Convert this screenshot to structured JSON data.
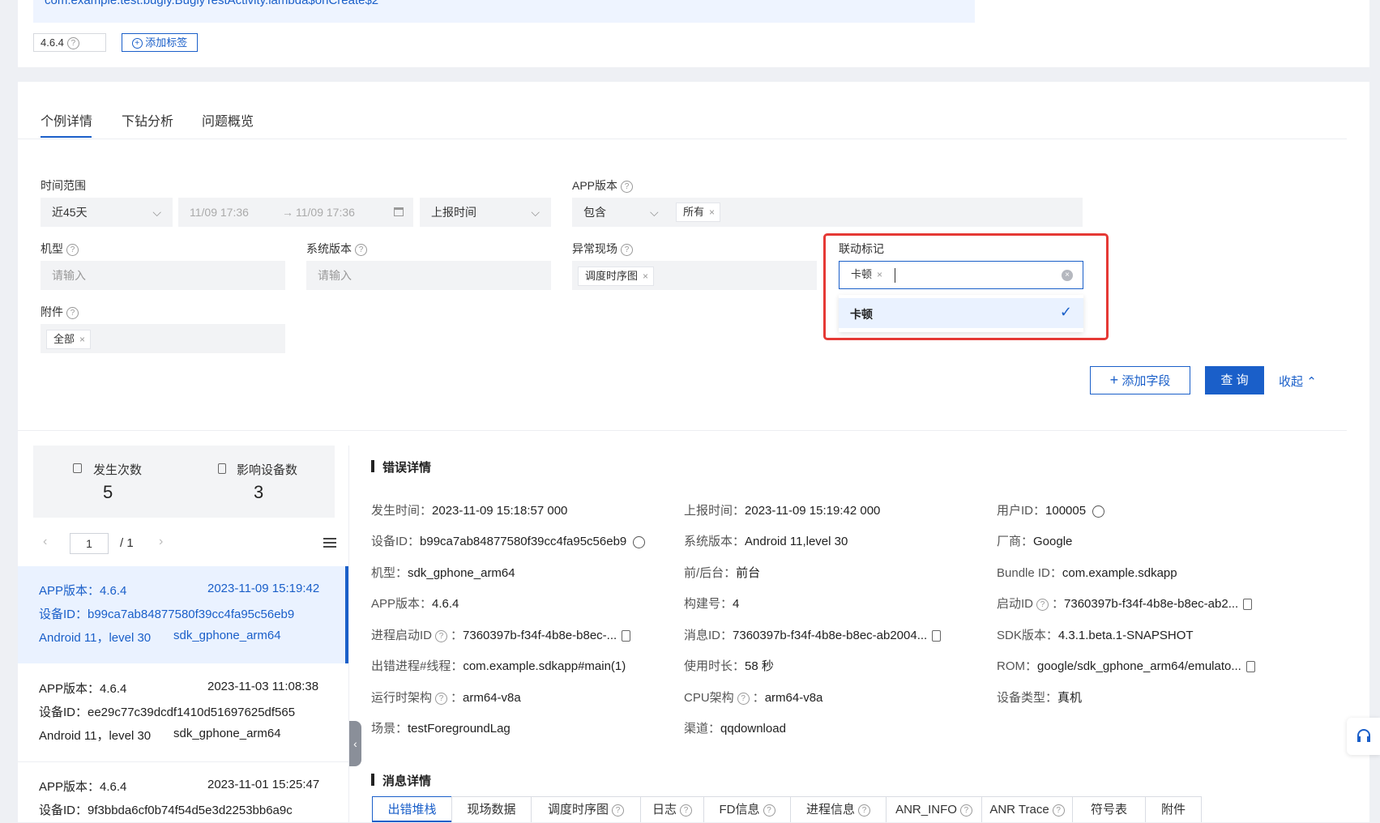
{
  "top": {
    "path_text": "com.example.test.bugly.BuglyTestActivity.lambda$onCreate$2",
    "version_chip": "4.6.4",
    "add_tag_button": "添加标签"
  },
  "tabs": [
    "个例详情",
    "下钻分析",
    "问题概览"
  ],
  "filters": {
    "time_range_label": "时间范围",
    "time_range_value": "近45天",
    "date_start": "11/09 17:36",
    "date_end": "11/09 17:36",
    "date_arrow": "→",
    "report_time": "上报时间",
    "app_version_label": "APP版本",
    "app_version_op": "包含",
    "app_version_tag": "所有",
    "model_label": "机型",
    "model_placeholder": "请输入",
    "os_label": "系统版本",
    "os_placeholder": "请输入",
    "scene_label": "异常现场",
    "scene_tag": "调度时序图",
    "link_label": "联动标记",
    "link_tag": "卡顿",
    "link_option": "卡顿",
    "attach_label": "附件",
    "attach_tag": "全部",
    "add_field_button": "添加字段",
    "query_button": "查 询",
    "collapse_button": "收起"
  },
  "stats": {
    "occur_label": "发生次数",
    "occur_value": "5",
    "device_label": "影响设备数",
    "device_value": "3"
  },
  "pager": {
    "page": "1",
    "total": "/ 1"
  },
  "list": [
    {
      "version": "APP版本：4.6.4",
      "time": "2023-11-09 15:19:42",
      "device": "设备ID：b99ca7ab84877580f39cc4fa95c56eb9",
      "os": "Android 11，level 30",
      "model": "sdk_gphone_arm64"
    },
    {
      "version": "APP版本：4.6.4",
      "time": "2023-11-03 11:08:38",
      "device": "设备ID：ee29c77c39dcdf1410d51697625df565",
      "os": "Android 11，level 30",
      "model": "sdk_gphone_arm64"
    },
    {
      "version": "APP版本：4.6.4",
      "time": "2023-11-01 15:25:47",
      "device": "设备ID：9f3bbda6cf0b74f54d5e3d2253bb6a9c",
      "os": "",
      "model": ""
    }
  ],
  "detail": {
    "section_title": "错误详情",
    "col1": [
      {
        "k": "发生时间：",
        "v": "2023-11-09 15:18:57 000"
      },
      {
        "k": "设备ID：",
        "v": "b99ca7ab84877580f39cc4fa95c56eb9"
      },
      {
        "k": "机型：",
        "v": "sdk_gphone_arm64"
      },
      {
        "k": "APP版本：",
        "v": "4.6.4"
      },
      {
        "k": "进程启动ID",
        "v": "7360397b-f34f-4b8e-b8ec-..."
      },
      {
        "k": "出错进程#线程：",
        "v": "com.example.sdkapp#main(1)"
      },
      {
        "k": "运行时架构",
        "v": "arm64-v8a"
      },
      {
        "k": "场景：",
        "v": "testForegroundLag"
      }
    ],
    "col2": [
      {
        "k": "上报时间：",
        "v": "2023-11-09 15:19:42 000"
      },
      {
        "k": "系统版本：",
        "v": "Android 11,level 30"
      },
      {
        "k": "前/后台：",
        "v": "前台"
      },
      {
        "k": "构建号：",
        "v": "4"
      },
      {
        "k": "消息ID：",
        "v": "7360397b-f34f-4b8e-b8ec-ab2004..."
      },
      {
        "k": "使用时长：",
        "v": "58 秒"
      },
      {
        "k": "CPU架构",
        "v": "arm64-v8a"
      },
      {
        "k": "渠道：",
        "v": "qqdownload"
      }
    ],
    "col3": [
      {
        "k": "用户ID：",
        "v": "100005"
      },
      {
        "k": "厂商：",
        "v": "Google"
      },
      {
        "k": "Bundle ID：",
        "v": "com.example.sdkapp"
      },
      {
        "k": "启动ID",
        "v": "7360397b-f34f-4b8e-b8ec-ab2..."
      },
      {
        "k": "SDK版本：",
        "v": "4.3.1.beta.1-SNAPSHOT"
      },
      {
        "k": "ROM：",
        "v": "google/sdk_gphone_arm64/emulato..."
      },
      {
        "k": "设备类型：",
        "v": "真机"
      }
    ]
  },
  "message": {
    "section_title": "消息详情",
    "tabs": [
      "出错堆栈",
      "现场数据",
      "调度时序图",
      "日志",
      "FD信息",
      "进程信息",
      "ANR_INFO",
      "ANR Trace",
      "符号表",
      "附件"
    ]
  }
}
